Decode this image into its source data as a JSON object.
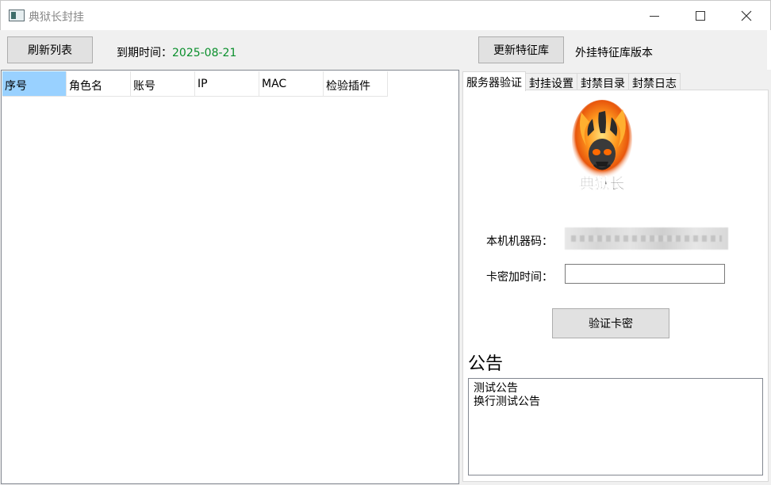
{
  "window": {
    "title": "典狱长封挂",
    "icon": "app-window-icon"
  },
  "toolbar": {
    "refresh_label": "刷新列表",
    "expire_label": "到期时间：",
    "expire_value": "2025-08-21",
    "expire_color": "#0a8f2c",
    "update_label": "更新特征库",
    "lib_version_label": "外挂特征库版本"
  },
  "list": {
    "columns": [
      "序号",
      "角色名",
      "账号",
      "IP",
      "MAC",
      "检验插件"
    ],
    "selected_column": 0,
    "selected_color": "#99d1ff"
  },
  "tabs": [
    "服务器验证",
    "封挂设置",
    "封禁目录",
    "封禁日志"
  ],
  "active_tab": 0,
  "verify": {
    "logo_text": "典狱长",
    "machine_code_label": "本机机器码：",
    "card_time_label": "卡密加时间：",
    "card_input_value": "",
    "verify_button": "验证卡密"
  },
  "notice": {
    "title": "公告",
    "content": "测试公告\n换行测试公告"
  }
}
